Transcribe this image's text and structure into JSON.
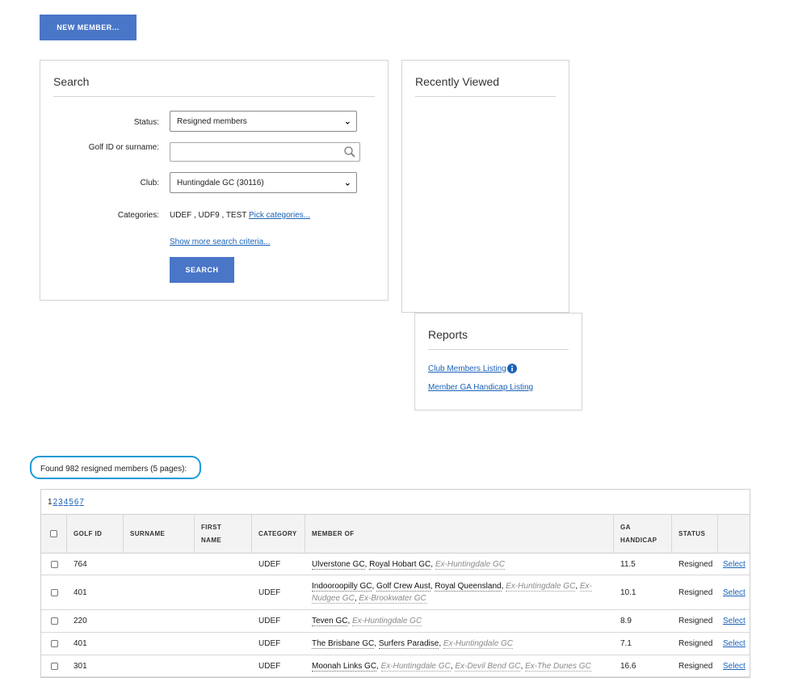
{
  "toolbar": {
    "new_member_label": "NEW MEMBER..."
  },
  "search": {
    "title": "Search",
    "status_label": "Status:",
    "status_value": "Resigned members",
    "golfid_label": "Golf ID or surname:",
    "golfid_value": "",
    "club_label": "Club:",
    "club_value": "Huntingdale GC (30116)",
    "categories_label": "Categories:",
    "categories_value": "UDEF , UDF9 , TEST",
    "pick_categories": "Pick categories...",
    "more_criteria": "Show more search criteria...",
    "search_button": "SEARCH"
  },
  "recent": {
    "title": "Recently Viewed"
  },
  "reports": {
    "title": "Reports",
    "items": [
      "Club Members Listing",
      "Member GA Handicap Listing"
    ]
  },
  "results": {
    "found_text": "Found 982 resigned members (5 pages):",
    "current_page": "1",
    "pages": [
      "2",
      "3",
      "4",
      "5",
      "6",
      "7"
    ],
    "headers": {
      "golf_id": "GOLF ID",
      "surname": "SURNAME",
      "first_name_1": "FIRST",
      "first_name_2": "NAME",
      "category": "CATEGORY",
      "member_of": "MEMBER OF",
      "handicap_1": "GA",
      "handicap_2": "HANDICAP",
      "status": "STATUS"
    },
    "rows": [
      {
        "golf_id": "764",
        "surname": "",
        "first": "",
        "category": "UDEF",
        "clubs": [
          "Ulverstone GC",
          "Royal Hobart GC"
        ],
        "ex": [
          "Ex-Huntingdale GC"
        ],
        "handicap": "11.5",
        "status": "Resigned",
        "action": "Select"
      },
      {
        "golf_id": "401",
        "surname": "",
        "first": "",
        "category": "UDEF",
        "clubs": [
          "Indooroopilly GC",
          "Golf Crew Aust",
          "Royal Queensland"
        ],
        "ex": [
          "Ex-Huntingdale GC",
          "Ex-Nudgee GC",
          "Ex-Brookwater GC"
        ],
        "handicap": "10.1",
        "status": "Resigned",
        "action": "Select"
      },
      {
        "golf_id": "220",
        "surname": "",
        "first": "",
        "category": "UDEF",
        "clubs": [
          "Teven GC"
        ],
        "ex": [
          "Ex-Huntingdale GC"
        ],
        "handicap": "8.9",
        "status": "Resigned",
        "action": "Select"
      },
      {
        "golf_id": "401",
        "surname": "",
        "first": "",
        "category": "UDEF",
        "clubs": [
          "The Brisbane GC",
          "Surfers Paradise"
        ],
        "ex": [
          "Ex-Huntingdale GC"
        ],
        "handicap": "7.1",
        "status": "Resigned",
        "action": "Select"
      },
      {
        "golf_id": "301",
        "surname": "",
        "first": "",
        "category": "UDEF",
        "clubs": [
          "Moonah Links GC"
        ],
        "ex": [
          "Ex-Huntingdale GC",
          "Ex-Devil Bend GC",
          "Ex-The Dunes GC"
        ],
        "handicap": "16.6",
        "status": "Resigned",
        "action": "Select"
      }
    ]
  },
  "colors": {
    "accent": "#4a76c8",
    "link": "#1a62b8",
    "highlight_ring": "#1a9ad6"
  }
}
